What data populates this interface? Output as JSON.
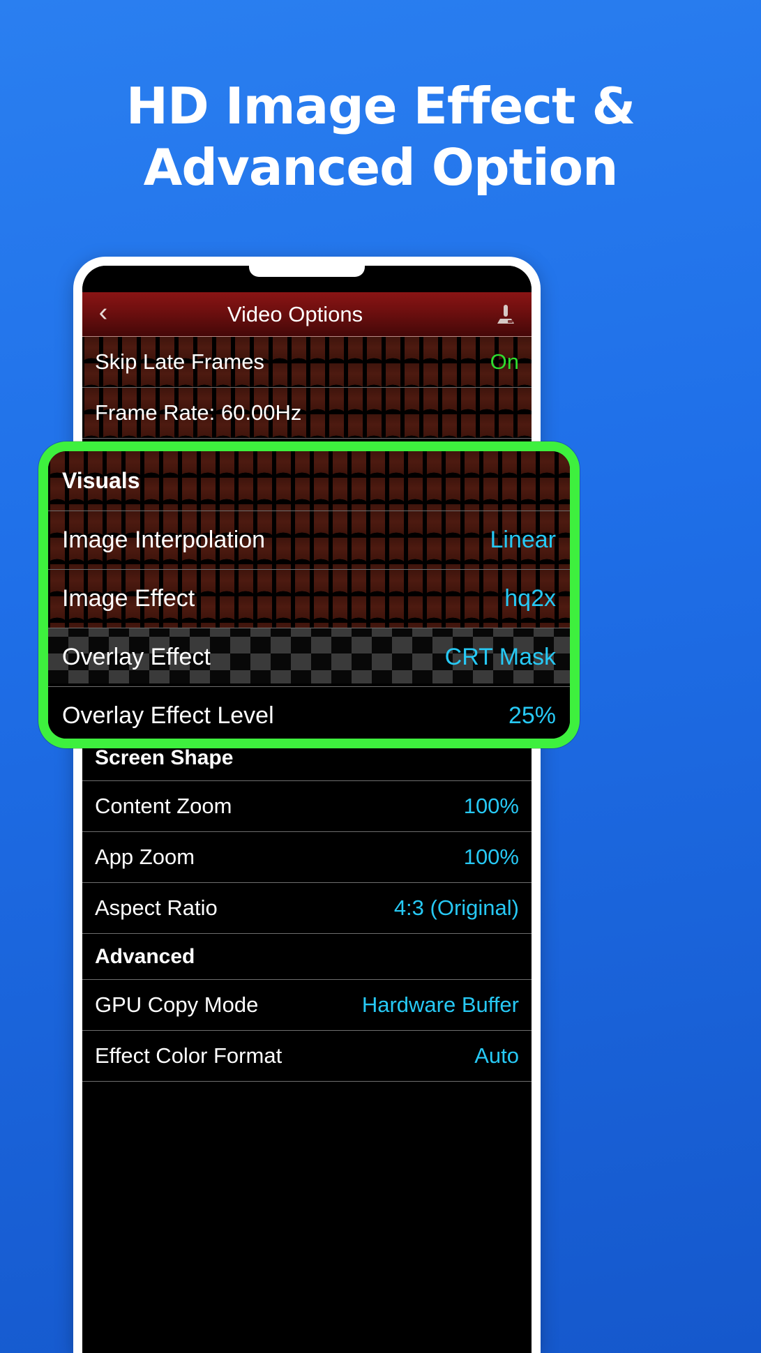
{
  "promo": {
    "headline_line1": "HD Image Effect &",
    "headline_line2": "Advanced Option",
    "background_color": "#1f6fe8",
    "highlight_color": "#3ef03e"
  },
  "app": {
    "header": {
      "back_icon": "chevron-left-icon",
      "title": "Video Options",
      "action_icon": "joystick-icon"
    },
    "accent_value_color": "#27c9f5",
    "enabled_value_color": "#2fdd2f",
    "rows_top": [
      {
        "label": "Skip Late Frames",
        "value": "On",
        "value_style": "green",
        "type": "item"
      },
      {
        "label": "Frame Rate: 60.00Hz",
        "value": "",
        "value_style": "none",
        "type": "item"
      }
    ],
    "highlighted_section": {
      "section_title": "Visuals",
      "rows": [
        {
          "label": "Image Interpolation",
          "value": "Linear",
          "value_style": "cyan"
        },
        {
          "label": "Image Effect",
          "value": "hq2x",
          "value_style": "cyan"
        },
        {
          "label": "Overlay Effect",
          "value": "CRT Mask",
          "value_style": "cyan"
        },
        {
          "label": "Overlay Effect Level",
          "value": "25%",
          "value_style": "cyan"
        }
      ]
    },
    "rows_bottom": [
      {
        "label": "Screen Shape",
        "value": "",
        "value_style": "none",
        "type": "section"
      },
      {
        "label": "Content Zoom",
        "value": "100%",
        "value_style": "cyan",
        "type": "item"
      },
      {
        "label": "App Zoom",
        "value": "100%",
        "value_style": "cyan",
        "type": "item"
      },
      {
        "label": "Aspect Ratio",
        "value": "4:3 (Original)",
        "value_style": "cyan",
        "type": "item"
      },
      {
        "label": "Advanced",
        "value": "",
        "value_style": "none",
        "type": "section"
      },
      {
        "label": "GPU Copy Mode",
        "value": "Hardware Buffer",
        "value_style": "cyan",
        "type": "item"
      },
      {
        "label": "Effect Color Format",
        "value": "Auto",
        "value_style": "cyan",
        "type": "item"
      }
    ]
  }
}
